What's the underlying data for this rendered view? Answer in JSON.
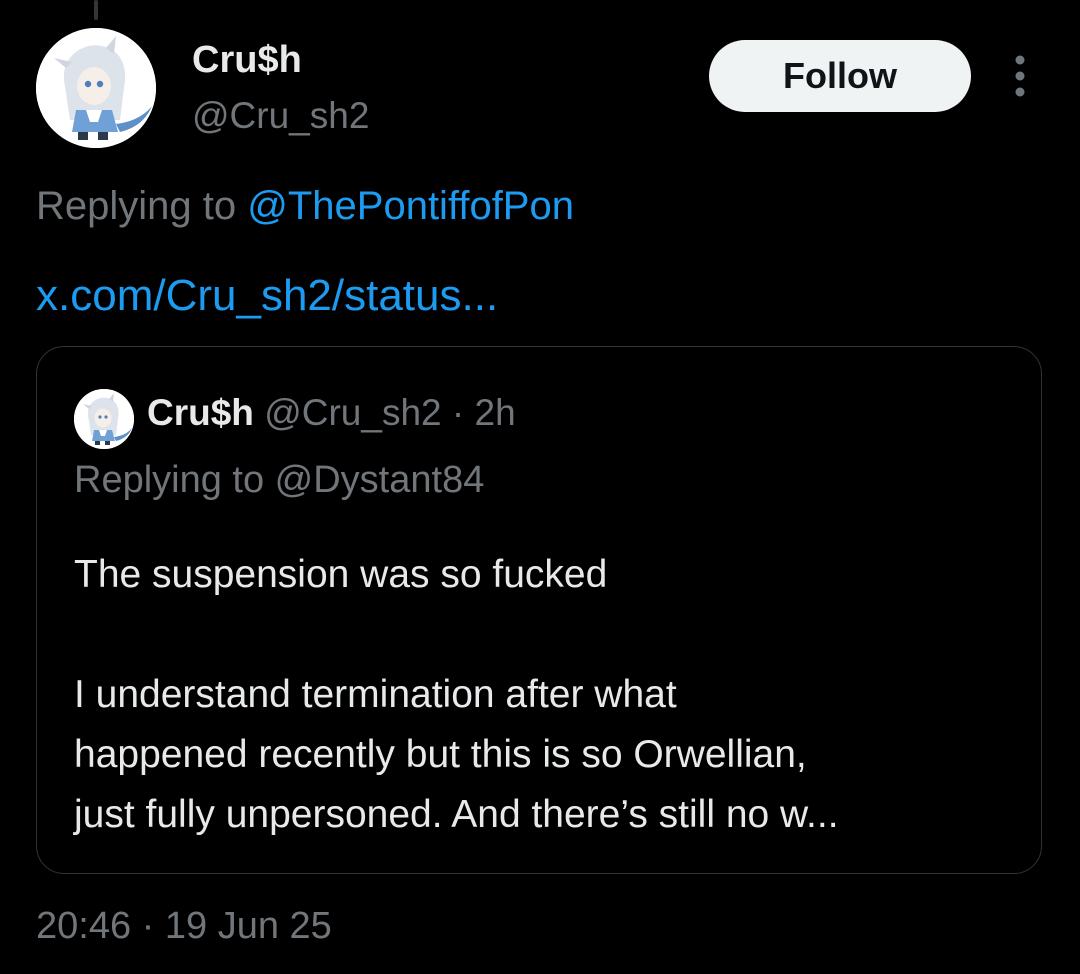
{
  "author": {
    "display_name": "Cru$h",
    "handle": "@Cru_sh2"
  },
  "follow_button": {
    "label": "Follow"
  },
  "more_menu": {
    "icon": "more-vertical-icon"
  },
  "reply_context": {
    "prefix": "Replying to ",
    "mention": "@ThePontiffofPon"
  },
  "link": {
    "text": "x.com/Cru_sh2/status..."
  },
  "quote": {
    "display_name": "Cru$h",
    "handle": "@Cru_sh2",
    "separator": "·",
    "time": "2h",
    "replying": "Replying to @Dystant84",
    "paragraphs": [
      [
        "The suspension was so fucked"
      ],
      [
        "I understand termination after what",
        "happened recently but this is so Orwellian,",
        "just fully unpersoned. And there’s still no w..."
      ]
    ]
  },
  "timestamp": "20:46 · 19 Jun 25",
  "colors": {
    "background": "#000000",
    "text_primary": "#e7e9ea",
    "text_secondary": "#71767b",
    "accent": "#1d9bf0",
    "border": "#2f3336",
    "button_bg": "#eff3f4"
  }
}
